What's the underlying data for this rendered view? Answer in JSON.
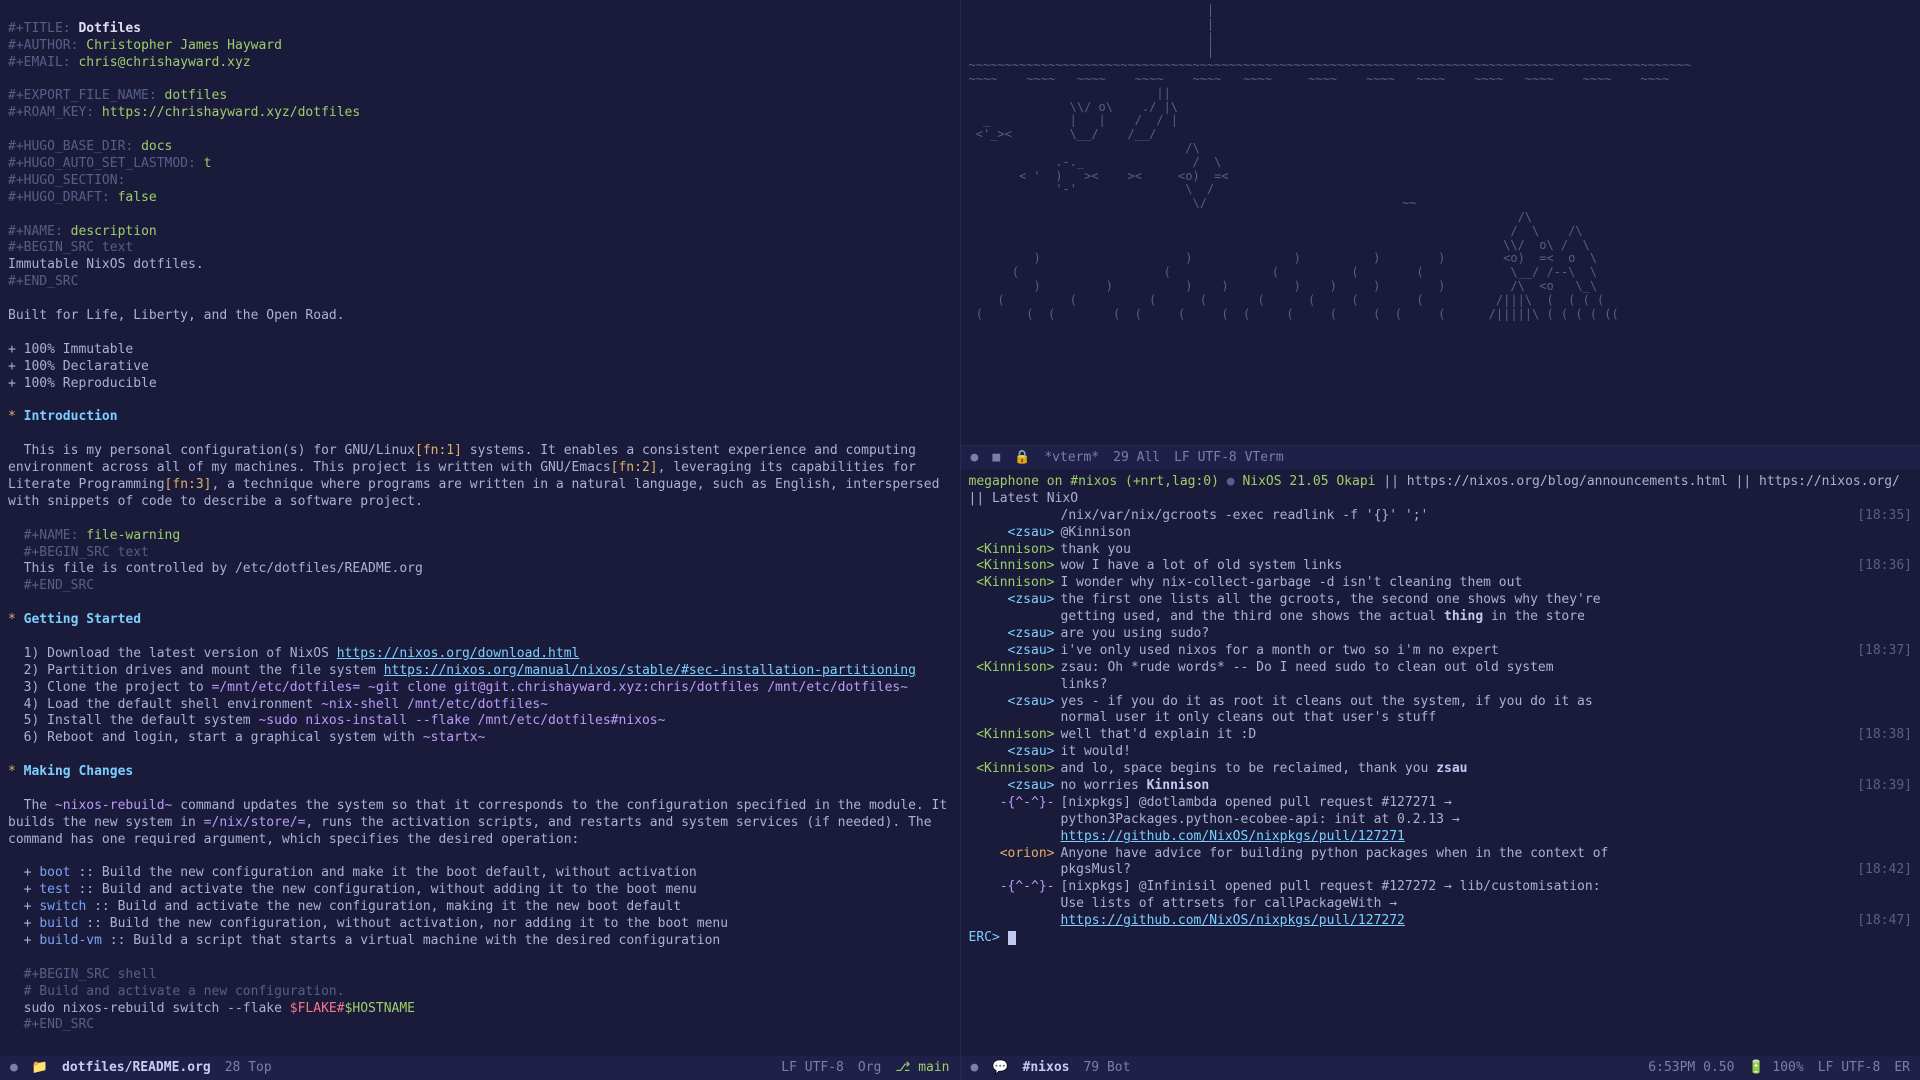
{
  "left": {
    "header": {
      "title_kw": "#+TITLE:",
      "title_val": "Dotfiles",
      "author_kw": "#+AUTHOR:",
      "author_val": "Christopher James Hayward",
      "email_kw": "#+EMAIL:",
      "email_val": "chris@chrishayward.xyz",
      "export_kw": "#+EXPORT_FILE_NAME:",
      "export_val": "dotfiles",
      "roam_kw": "#+ROAM_KEY:",
      "roam_val": "https://chrishayward.xyz/dotfiles",
      "hugo_base_kw": "#+HUGO_BASE_DIR:",
      "hugo_base_val": "docs",
      "hugo_last_kw": "#+HUGO_AUTO_SET_LASTMOD:",
      "hugo_last_val": "t",
      "hugo_sec_kw": "#+HUGO_SECTION:",
      "hugo_draft_kw": "#+HUGO_DRAFT:",
      "hugo_draft_val": "false"
    },
    "block1": {
      "name_kw": "#+NAME:",
      "name_val": "description",
      "begin": "#+BEGIN_SRC text",
      "body": "Immutable NixOS dotfiles.",
      "end": "#+END_SRC"
    },
    "tagline": "Built for Life, Liberty, and the Open Road.",
    "bullets": [
      "+ 100% Immutable",
      "+ 100% Declarative",
      "+ 100% Reproducible"
    ],
    "sec1": {
      "title": "Introduction",
      "p1a": "This is my personal configuration(s) for GNU/Linux",
      "fn1": "[fn:1]",
      "p1b": " systems. It enables a consistent experience and computing environment across all of my machines. This project is written with GNU/Emacs",
      "fn2": "[fn:2]",
      "p1c": ", leveraging its capabilities for Literate Programming",
      "fn3": "[fn:3]",
      "p1d": ", a technique where programs are written in a natural language, such as English, interspersed with snippets of code to describe a software project."
    },
    "block2": {
      "name_kw": "#+NAME:",
      "name_val": "file-warning",
      "begin": "#+BEGIN_SRC text",
      "body": "This file is controlled by /etc/dotfiles/README.org",
      "end": "#+END_SRC"
    },
    "sec2": {
      "title": "Getting Started",
      "l1a": "1) Download the latest version of NixOS ",
      "l1link": "https://nixos.org/download.html",
      "l2a": "2) Partition drives and mount the file system ",
      "l2link": "https://nixos.org/manual/nixos/stable/#sec-installation-partitioning",
      "l3a": "3) Clone the project to ",
      "l3code1": "=/mnt/etc/dotfiles=",
      "l3code2": " ~git clone git@git.chrishayward.xyz:chris/dotfiles /mnt/etc/dotfiles~",
      "l4a": "4) Load the default shell environment ",
      "l4code": "~nix-shell /mnt/etc/dotfiles~",
      "l5a": "5) Install the default system ",
      "l5code": "~sudo nixos-install --flake /mnt/etc/dotfiles#nixos~",
      "l6a": "6) Reboot and login, start a graphical system with ",
      "l6code": "~startx~"
    },
    "sec3": {
      "title": "Making Changes",
      "p1a": "The ",
      "p1code": "~nixos-rebuild~",
      "p1b": " command updates the system so that it corresponds to the configuration specified in the module. It builds the new system in ",
      "p1code2": "=/nix/store/=",
      "p1c": ", runs the activation scripts, and restarts and system services (if needed). The command has one required argument, which specifies the desired operation:",
      "items": [
        {
          "kw": "boot",
          "desc": ":: Build the new configuration and make it the boot default, without activation"
        },
        {
          "kw": "test",
          "desc": ":: Build and activate the new configuration, without adding it to the boot menu"
        },
        {
          "kw": "switch",
          "desc": ":: Build and activate the new configuration, making it the new boot default"
        },
        {
          "kw": "build",
          "desc": ":: Build the new configuration, without activation, nor adding it to the boot menu"
        },
        {
          "kw": "build-vm",
          "desc": ":: Build a script that starts a virtual machine with the desired configuration"
        }
      ],
      "src_begin": "#+BEGIN_SRC shell",
      "src_comment": "# Build and activate a new configuration.",
      "src_line": "sudo nixos-rebuild switch --flake ",
      "src_var1": "$FLAKE",
      "src_hash": "#",
      "src_var2": "$HOSTNAME",
      "src_end": "#+END_SRC"
    },
    "modeline": {
      "bullet": "●",
      "folder": "📁",
      "file": "dotfiles/README.org",
      "pos": "28 Top",
      "encoding": "LF UTF-8",
      "mode": "Org",
      "branch_icon": "⎇",
      "branch": "main"
    }
  },
  "vterm": {
    "modeline": {
      "bullet": "●",
      "lock": "🔒",
      "ro": "🔒",
      "name": "*vterm*",
      "pos": "29 All",
      "encoding": "LF UTF-8",
      "mode": "VTerm"
    }
  },
  "irc": {
    "topic_a": "megaphone on #nixos (+nrt,lag:0) ",
    "topic_sep": "● ",
    "topic_b": "NixOS 21.05 Okapi ",
    "topic_c": "|| https://nixos.org/blog/announcements.html || https://nixos.org/ || Latest NixO",
    "topic_line2": "/nix/var/nix/gcroots -exec readlink -f '{}' ';'",
    "time0": "[18:35]",
    "lines": [
      {
        "nick": "<zsau>",
        "nc": "nick2",
        "msg": "@Kinnison"
      },
      {
        "nick": "<Kinnison>",
        "nc": "nick1",
        "msg": "thank you"
      },
      {
        "nick": "<Kinnison>",
        "nc": "nick1",
        "msg": "wow I have a lot of old system links",
        "time": "[18:36]"
      },
      {
        "nick": "<Kinnison>",
        "nc": "nick1",
        "msg": "I wonder why nix-collect-garbage -d isn't cleaning them out"
      },
      {
        "nick": "<zsau>",
        "nc": "nick2",
        "msg": "the first one lists all the gcroots, the second one shows why they're"
      },
      {
        "nick": "",
        "nc": "",
        "msg": "getting used, and the third one shows the actual ",
        "bold": "thing",
        "msg2": " in the store"
      },
      {
        "nick": "<zsau>",
        "nc": "nick2",
        "msg": "are you using sudo?"
      },
      {
        "nick": "<zsau>",
        "nc": "nick2",
        "msg": "i've only used nixos for a month or two so i'm no expert",
        "time": "[18:37]"
      },
      {
        "nick": "<Kinnison>",
        "nc": "nick1",
        "msg": "zsau: Oh *rude words* -- Do I need sudo to clean out old system"
      },
      {
        "nick": "",
        "nc": "",
        "msg": "links?"
      },
      {
        "nick": "<zsau>",
        "nc": "nick2",
        "msg": "yes - if you do it as root it cleans out the system, if you do it as"
      },
      {
        "nick": "",
        "nc": "",
        "msg": "normal user it only cleans out that user's stuff"
      },
      {
        "nick": "<Kinnison>",
        "nc": "nick1",
        "msg": "well that'd explain it :D",
        "time": "[18:38]"
      },
      {
        "nick": "<zsau>",
        "nc": "nick2",
        "msg": "it would!"
      },
      {
        "nick": "<Kinnison>",
        "nc": "nick1",
        "msg": "and lo, space begins to be reclaimed, thank you ",
        "bold": "zsau"
      },
      {
        "nick": "<zsau>",
        "nc": "nick2",
        "msg": "no worries ",
        "bold": "Kinnison",
        "time": "[18:39]"
      },
      {
        "nick": "-{^-^}-",
        "nc": "nick3",
        "msg": "[nixpkgs] @dotlambda opened pull request #127271 →"
      },
      {
        "nick": "",
        "nc": "",
        "msg": "python3Packages.python-ecobee-api: init at 0.2.13 →"
      },
      {
        "nick": "",
        "nc": "",
        "link": "https://github.com/NixOS/nixpkgs/pull/127271"
      },
      {
        "nick": "<orion>",
        "nc": "nick4",
        "msg": "Anyone have advice for building python packages when in the context of"
      },
      {
        "nick": "",
        "nc": "",
        "msg": "pkgsMusl?",
        "time": "[18:42]"
      },
      {
        "nick": "-{^-^}-",
        "nc": "nick3",
        "msg": "[nixpkgs] @Infinisil opened pull request #127272 → lib/customisation:"
      },
      {
        "nick": "",
        "nc": "",
        "msg": "Use lists of attrsets for callPackageWith →"
      },
      {
        "nick": "",
        "nc": "",
        "link": "https://github.com/NixOS/nixpkgs/pull/127272",
        "time": "[18:47]"
      }
    ],
    "prompt": "ERC> ",
    "modeline": {
      "bullet": "●",
      "chat": "💬",
      "chan": "#nixos",
      "pos": "79 Bot",
      "clock": "6:53PM 0.50",
      "bat": "🔋 100%",
      "encoding": "LF UTF-8",
      "mode": "ER"
    }
  },
  "ascii_art": "                                 |\n                                 |\n                                 |\n                                 |\n~~~~~~~~~~~~~~~~~~~~~~~~~~~~~~~~~~~~~~~~~~~~~~~~~~~~~~~~~~~~~~~~~~~~~~~~~~~~~~~~~~~~~~~~~~~~~~~~~~~~\n~~~~    ~~~~   ~~~~    ~~~~    ~~~~   ~~~~     ~~~~    ~~~~   ~~~~    ~~~~   ~~~~    ~~~~    ~~~~\n                          ||\n              \\\\/ o\\    ./ |\\\n  _           |   |    /  / |\n <'_><        \\__/    /__/\n                              /\\\n            .-._               /  \\\n       < '  )   ><    ><     <o)  =<\n            '-'               \\  /\n                               \\/                           ~~\n                                                                            /\\\n                                                                           /  \\    /\\\n                                                                          \\\\/  o\\ /  \\\n         )                    )              )          )        )        <o)  =<  o  \\\n      (                    (              (          (        (            \\__/ /--\\  \\\n         )         )          )    )         )    )     )        )         /\\  <o   \\_\\\n    (         (          (      (       (      (     (        (          /|||\\  (  ( ( (\n (      (  (        (  (     (     (  (     (     (     (  (     (      /|||||\\ ( ( ( ( (("
}
